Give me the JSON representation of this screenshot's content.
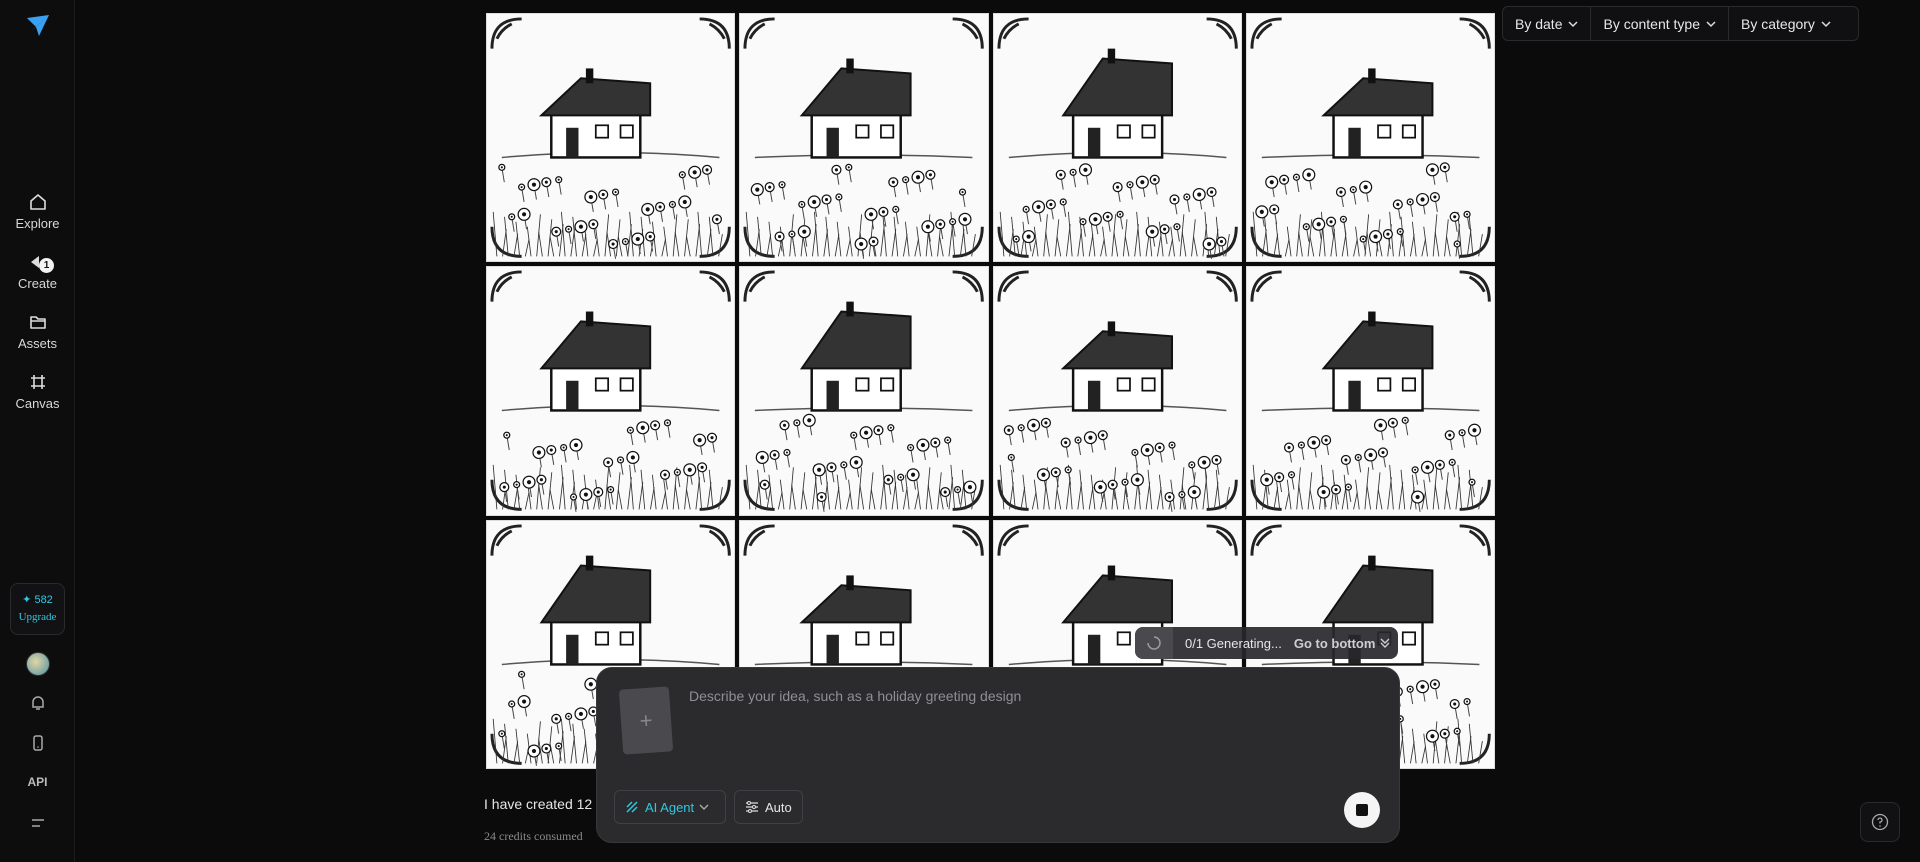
{
  "sidebar": {
    "nav": [
      {
        "label": "Explore",
        "icon": "home-icon"
      },
      {
        "label": "Create",
        "icon": "create-icon",
        "badge": "1"
      },
      {
        "label": "Assets",
        "icon": "folder-icon"
      },
      {
        "label": "Canvas",
        "icon": "canvas-icon"
      }
    ],
    "credits": "✦ 582",
    "upgrade": "Upgrade",
    "api": "API"
  },
  "filters": {
    "date": "By date",
    "content_type": "By content type",
    "category": "By category"
  },
  "generating": {
    "status": "0/1 Generating...",
    "goto": "Go to bottom"
  },
  "prompt": {
    "placeholder": "Describe your idea, such as a holiday greeting design",
    "mode": "AI Agent",
    "auto": "Auto"
  },
  "result": {
    "message": "I have created 12",
    "credits": "24 credits consumed"
  },
  "theme": {
    "accent": "#2fc8e2"
  }
}
